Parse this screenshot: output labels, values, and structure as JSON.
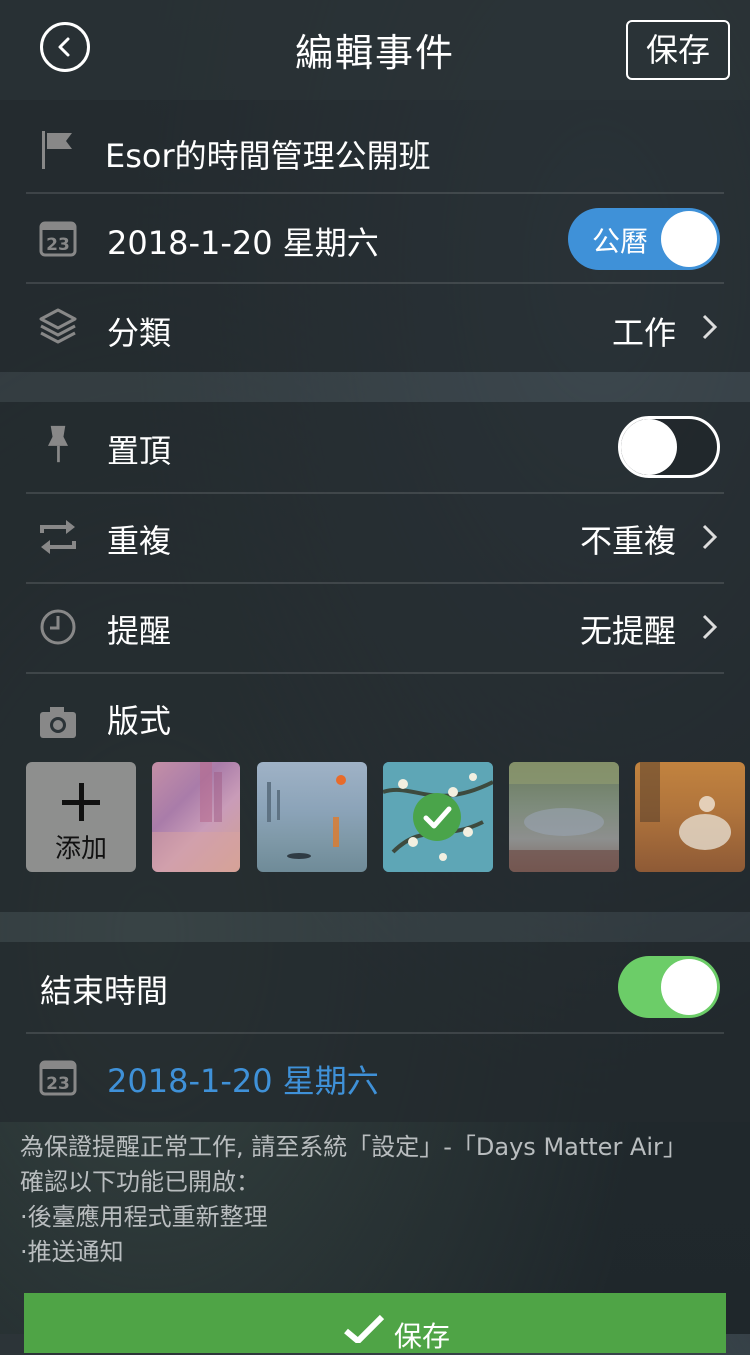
{
  "header": {
    "title": "編輯事件",
    "save_label": "保存",
    "back_icon": "back-circle-icon"
  },
  "event": {
    "name": "Esor的時間管理公開班",
    "date": "2018-1-20 星期六",
    "calendar_toggle_label": "公曆",
    "category_label": "分類",
    "category_value": "工作"
  },
  "options": {
    "pin_label": "置頂",
    "pin_on": false,
    "repeat_label": "重複",
    "repeat_value": "不重複",
    "reminder_label": "提醒",
    "reminder_value": "无提醒",
    "style_label": "版式",
    "add_label": "添加",
    "selected_theme_index": 2
  },
  "end": {
    "label": "結束時間",
    "enabled": true,
    "date": "2018-1-20 星期六"
  },
  "note": {
    "line1": "為保證提醒正常工作, 請至系統「設定」-「Days Matter Air」",
    "line2": "確認以下功能已開啟：",
    "line3": "·後臺應用程式重新整理",
    "line4": "·推送通知"
  },
  "bottom": {
    "save_label": "保存"
  },
  "colors": {
    "accent_blue": "#3f91d8",
    "toggle_green": "#6ccd68",
    "save_green": "#4fa446",
    "date_blue": "#3f91d8"
  }
}
